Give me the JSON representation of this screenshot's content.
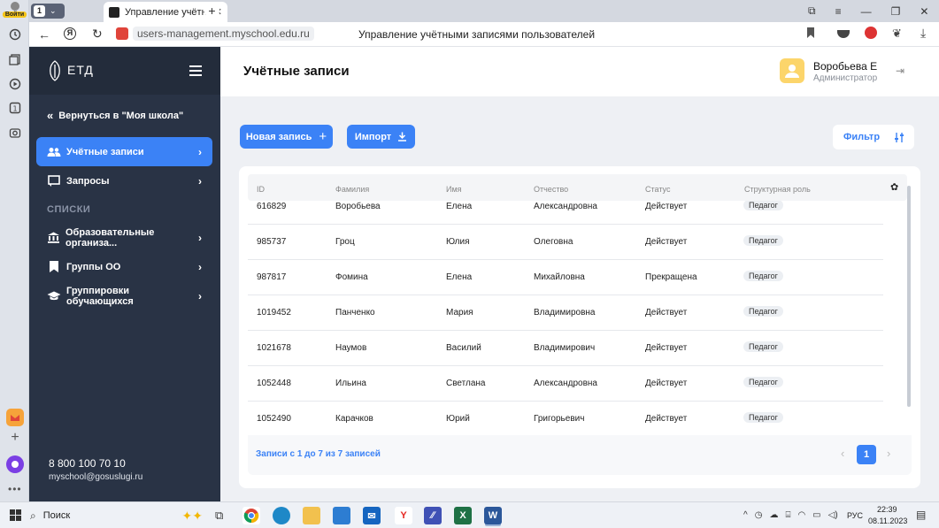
{
  "browser": {
    "login_label": "Войти",
    "tab_counter": "1",
    "tab_title": "Управление учётными",
    "url": "users-management.myschool.edu.ru",
    "page_title": "Управление учётными записями пользователей"
  },
  "sidebar": {
    "logo_text": "ЕТД",
    "back_link": "Вернуться в \"Моя школа\"",
    "items": [
      {
        "label": "Учётные записи",
        "active": true
      },
      {
        "label": "Запросы"
      }
    ],
    "section_label": "СПИСКИ",
    "lists": [
      {
        "label": "Образовательные организа..."
      },
      {
        "label": "Группы ОО"
      },
      {
        "label": "Группировки обучающихся"
      }
    ],
    "phone": "8 800 100 70 10",
    "email": "myschool@gosuslugi.ru"
  },
  "header": {
    "title": "Учётные записи",
    "user_name": "Воробьева Е",
    "user_role": "Администратор"
  },
  "toolbar": {
    "new_record": "Новая запись",
    "import": "Импорт",
    "filter": "Фильтр"
  },
  "table": {
    "columns": [
      "ID",
      "Фамилия",
      "Имя",
      "Отчество",
      "Статус",
      "Структурная роль"
    ],
    "rows": [
      [
        "616829",
        "Воробьева",
        "Елена",
        "Александровна",
        "Действует",
        "Педагог"
      ],
      [
        "985737",
        "Гроц",
        "Юлия",
        "Олеговна",
        "Действует",
        "Педагог"
      ],
      [
        "987817",
        "Фомина",
        "Елена",
        "Михайловна",
        "Прекращена",
        "Педагог"
      ],
      [
        "1019452",
        "Панченко",
        "Мария",
        "Владимировна",
        "Действует",
        "Педагог"
      ],
      [
        "1021678",
        "Наумов",
        "Василий",
        "Владимирович",
        "Действует",
        "Педагог"
      ],
      [
        "1052448",
        "Ильина",
        "Светлана",
        "Александровна",
        "Действует",
        "Педагог"
      ],
      [
        "1052490",
        "Карачков",
        "Юрий",
        "Григорьевич",
        "Действует",
        "Педагог"
      ]
    ],
    "footer": "Записи с 1 до 7 из 7 записей",
    "current_page": "1"
  },
  "taskbar": {
    "search": "Поиск",
    "lang": "РУС",
    "time": "22:39",
    "date": "08.11.2023"
  },
  "colors": {
    "accent": "#3b82f6",
    "sidebar": "#293345"
  }
}
